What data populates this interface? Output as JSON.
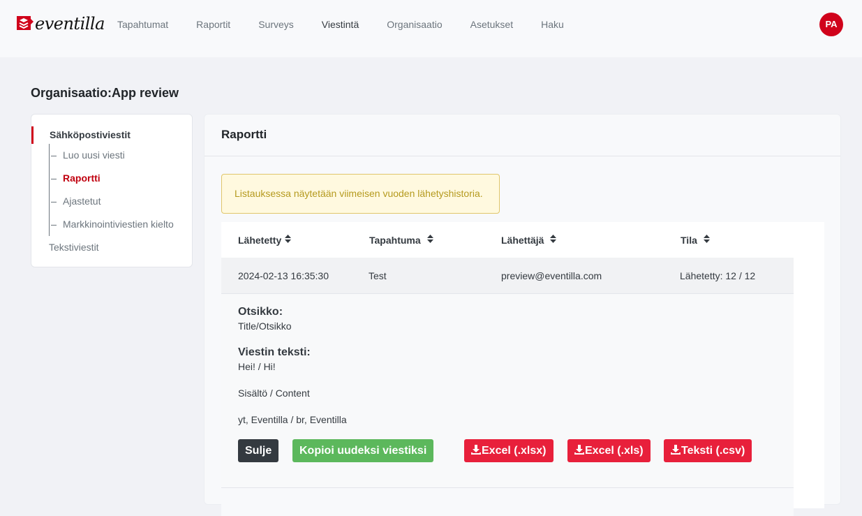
{
  "brand": {
    "name": "eventilla",
    "accent": "#d0021b"
  },
  "nav": {
    "items": [
      "Tapahtumat",
      "Raportit",
      "Surveys",
      "Viestintä",
      "Organisaatio",
      "Asetukset",
      "Haku"
    ],
    "active": "Viestintä"
  },
  "user": {
    "initials": "PA"
  },
  "page": {
    "title": "Organisaatio:App review"
  },
  "sidebar": {
    "section": "Sähköpostiviestit",
    "subitems": [
      "Luo uusi viesti",
      "Raportti",
      "Ajastetut",
      "Markkinointiviestien kielto"
    ],
    "active_sub": "Raportti",
    "item": "Tekstiviestit"
  },
  "card": {
    "title": "Raportti"
  },
  "alert": {
    "text": "Listauksessa näytetään viimeisen vuoden lähetyshistoria."
  },
  "table": {
    "headers": [
      "Lähetetty",
      "Tapahtuma",
      "Lähettäjä",
      "Tila"
    ],
    "row": {
      "sent": "2024-02-13 16:35:30",
      "event": "Test",
      "sender": "preview@eventilla.com",
      "status": "Lähetetty: 12 / 12"
    }
  },
  "detail": {
    "subject_label": "Otsikko:",
    "subject": "Title/Otsikko",
    "body_label": "Viestin teksti:",
    "body_lines": [
      "Hei! / Hi!",
      "Sisältö / Content",
      "yt, Eventilla / br, Eventilla"
    ]
  },
  "buttons": {
    "close": "Sulje",
    "copy": "Kopioi uudeksi viestiksi",
    "xlsx": "Excel (.xlsx)",
    "xls": "Excel (.xls)",
    "csv": "Teksti (.csv)"
  }
}
